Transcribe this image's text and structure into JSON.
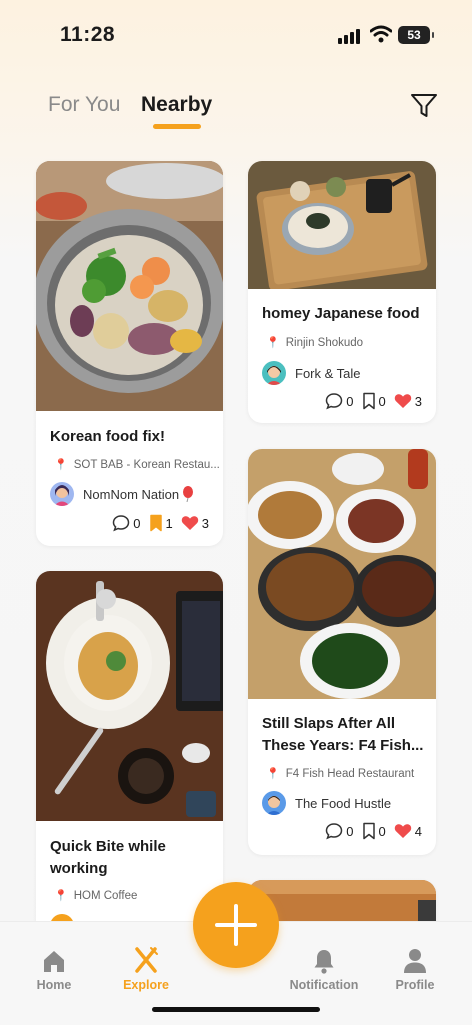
{
  "status_bar": {
    "time": "11:28",
    "battery": "53"
  },
  "tabs": [
    {
      "label": "For You",
      "active": false
    },
    {
      "label": "Nearby",
      "active": true
    }
  ],
  "posts": [
    {
      "title": "Korean food fix!",
      "location": "SOT BAB - Korean Restau...",
      "author": "NomNom Nation",
      "comments": "0",
      "saves": "1",
      "likes": "3"
    },
    {
      "title": "homey Japanese food",
      "location": "Rinjin Shokudo",
      "author": "Fork & Tale",
      "comments": "0",
      "saves": "0",
      "likes": "3"
    },
    {
      "title": "Still Slaps After All These Years: F4 Fish...",
      "location": "F4 Fish Head Restaurant",
      "author": "The Food Hustle",
      "comments": "0",
      "saves": "0",
      "likes": "4"
    },
    {
      "title": "Quick Bite while working",
      "location": "HOM Coffee"
    }
  ],
  "nav": {
    "home": "Home",
    "explore": "Explore",
    "notification": "Notification",
    "profile": "Profile"
  },
  "colors": {
    "accent": "#f5a11d",
    "pin": "#e23a2e",
    "heart": "#ef4b4b"
  }
}
